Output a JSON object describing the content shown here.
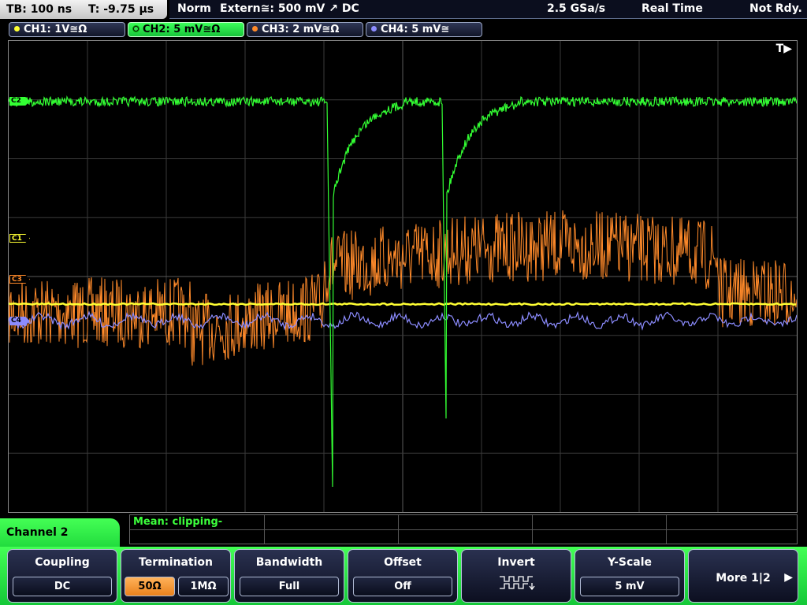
{
  "status": {
    "timebase": "TB: 100 ns",
    "trigger_time": "T: -9.75 µs",
    "trigger_mode": "Norm",
    "trigger_source": "Extern≅: 500 mV ↗ DC",
    "sample_rate": "2.5 GSa/s",
    "acquisition": "Real Time",
    "run_state": "Not Rdy."
  },
  "channels": [
    {
      "label": "CH1: 1V≅Ω",
      "color": "#ffff33",
      "marker": "C1"
    },
    {
      "label": "CH2: 5 mV≅Ω",
      "color": "#33ff33",
      "marker": "C2"
    },
    {
      "label": "CH3: 2 mV≅Ω",
      "color": "#ff8a2a",
      "marker": "C3"
    },
    {
      "label": "CH4: 5 mV≅",
      "color": "#8c8cff",
      "marker": "C4"
    }
  ],
  "trigger_position_marker": "T▶",
  "measurement": {
    "text": "Mean: clipping-"
  },
  "menu": {
    "title": "Channel 2",
    "softkeys": {
      "coupling": {
        "label": "Coupling",
        "value": "DC"
      },
      "termination": {
        "label": "Termination",
        "options": [
          "50Ω",
          "1MΩ"
        ],
        "selected": "50Ω"
      },
      "bandwidth": {
        "label": "Bandwidth",
        "value": "Full"
      },
      "offset": {
        "label": "Offset",
        "value": "Off"
      },
      "invert": {
        "label": "Invert",
        "icon": "invert-waveform-icon"
      },
      "yscale": {
        "label": "Y-Scale",
        "value": "5 mV"
      },
      "more": {
        "label": "More 1|2",
        "icon": "play-arrow-icon"
      }
    }
  }
}
